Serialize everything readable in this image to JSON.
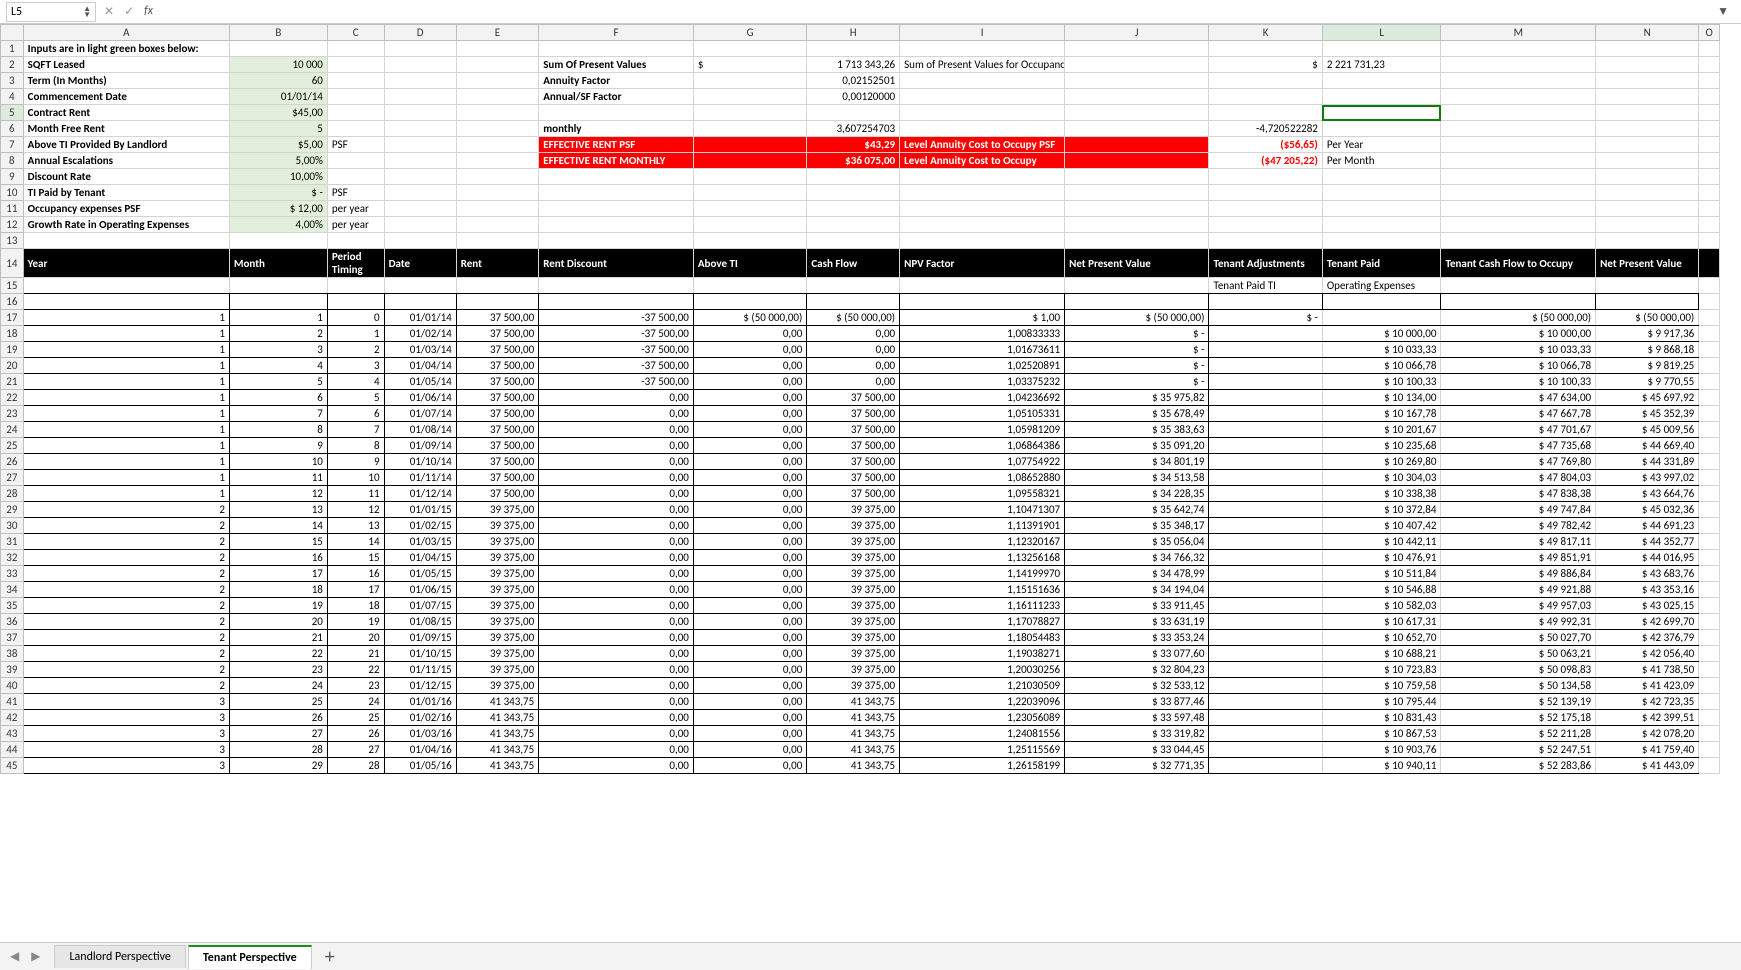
{
  "formula_bar": {
    "cell_ref": "L5",
    "fx": "fx",
    "formula": ""
  },
  "tabs": {
    "prev": "◀",
    "next": "▶",
    "t1": "Landlord Perspective",
    "t2": "Tenant Perspective",
    "add": "＋"
  },
  "cols": [
    "",
    "A",
    "B",
    "C",
    "D",
    "E",
    "F",
    "G",
    "H",
    "I",
    "J",
    "K",
    "L",
    "M",
    "N",
    "O"
  ],
  "r1": {
    "A": "Inputs are in light green boxes below:"
  },
  "r2": {
    "A": "SQFT Leased",
    "B": "10 000",
    "F": "Sum Of Present Values",
    "G": "$",
    "H": "1 713 343,26",
    "I": "Sum of Present Values for Occupancy",
    "K": "$",
    "L": "2 221 731,23"
  },
  "r3": {
    "A": "Term (In Months)",
    "B": "60",
    "F": "Annuity Factor",
    "H": "0,02152501"
  },
  "r4": {
    "A": "Commencement Date",
    "B": "01/01/14",
    "F": "Annual/SF Factor",
    "H": "0,00120000"
  },
  "r5": {
    "A": "Contract Rent",
    "B": "$45,00"
  },
  "r6": {
    "A": "Month Free Rent",
    "B": "5",
    "F": "monthly",
    "H": "3,607254703",
    "K": "-4,720522282"
  },
  "r7": {
    "A": "Above TI Provided By Landlord",
    "B": "$5,00",
    "C": "PSF",
    "F": "EFFECTIVE RENT PSF",
    "H": "$43,29",
    "I": "Level Annuity Cost to Occupy PSF",
    "K": "($56,65)",
    "L": "Per Year"
  },
  "r8": {
    "A": "Annual Escalations",
    "B": "5,00%",
    "F": "EFFECTIVE RENT MONTHLY",
    "H": "$36 075,00",
    "I": "Level Annuity Cost to Occupy",
    "K": "($47 205,22)",
    "L": "Per Month"
  },
  "r9": {
    "A": "Discount Rate",
    "B": "10,00%"
  },
  "r10": {
    "A": "TI Paid by Tenant",
    "Bp": "$",
    "B": "-",
    "C": "PSF"
  },
  "r11": {
    "A": "Occupancy expenses PSF",
    "Bp": "$",
    "B": "12,00",
    "C": "per year"
  },
  "r12": {
    "A": "Growth Rate in Operating Expenses",
    "B": "4,00%",
    "C": "per year"
  },
  "hdr": {
    "A": "Year",
    "B": "Month",
    "C": "Period Timing",
    "D": "Date",
    "E": "Rent",
    "F": "Rent Discount",
    "G": "Above TI",
    "H": "Cash Flow",
    "I": "NPV Factor",
    "J": "Net Present Value",
    "K": "Tenant Adjustments",
    "L": "Tenant Paid",
    "M": "Tenant Cash Flow to Occupy",
    "N": "Net Present Value"
  },
  "r15": {
    "K": "Tenant Paid TI",
    "L": "Operating Expenses"
  },
  "rows": [
    {
      "n": 17,
      "A": "1",
      "B": "1",
      "C": "0",
      "D": "01/01/14",
      "E": "37 500,00",
      "F": "-37 500,00",
      "Gp": "$",
      "G": "(50 000,00)",
      "Hp": "$",
      "H": "(50 000,00)",
      "Ip": "$",
      "I": "1,00",
      "Jp": "$",
      "J": "(50 000,00)",
      "Kp": "$",
      "K": "-",
      "Lp": "",
      "L": "",
      "Mp": "$",
      "M": "(50 000,00)",
      "Np": "$",
      "N": "(50 000,00)"
    },
    {
      "n": 18,
      "A": "1",
      "B": "2",
      "C": "1",
      "D": "01/02/14",
      "E": "37 500,00",
      "F": "-37 500,00",
      "G": "0,00",
      "H": "0,00",
      "I": "1,00833333",
      "Jp": "$",
      "J": "-",
      "Lp": "$",
      "L": "10 000,00",
      "Mp": "$",
      "M": "10 000,00",
      "Np": "$",
      "N": "9 917,36"
    },
    {
      "n": 19,
      "A": "1",
      "B": "3",
      "C": "2",
      "D": "01/03/14",
      "E": "37 500,00",
      "F": "-37 500,00",
      "G": "0,00",
      "H": "0,00",
      "I": "1,01673611",
      "Jp": "$",
      "J": "-",
      "Lp": "$",
      "L": "10 033,33",
      "Mp": "$",
      "M": "10 033,33",
      "Np": "$",
      "N": "9 868,18"
    },
    {
      "n": 20,
      "A": "1",
      "B": "4",
      "C": "3",
      "D": "01/04/14",
      "E": "37 500,00",
      "F": "-37 500,00",
      "G": "0,00",
      "H": "0,00",
      "I": "1,02520891",
      "Jp": "$",
      "J": "-",
      "Lp": "$",
      "L": "10 066,78",
      "Mp": "$",
      "M": "10 066,78",
      "Np": "$",
      "N": "9 819,25"
    },
    {
      "n": 21,
      "A": "1",
      "B": "5",
      "C": "4",
      "D": "01/05/14",
      "E": "37 500,00",
      "F": "-37 500,00",
      "G": "0,00",
      "H": "0,00",
      "I": "1,03375232",
      "Jp": "$",
      "J": "-",
      "Lp": "$",
      "L": "10 100,33",
      "Mp": "$",
      "M": "10 100,33",
      "Np": "$",
      "N": "9 770,55"
    },
    {
      "n": 22,
      "A": "1",
      "B": "6",
      "C": "5",
      "D": "01/06/14",
      "E": "37 500,00",
      "F": "0,00",
      "G": "0,00",
      "H": "37 500,00",
      "I": "1,04236692",
      "Jp": "$",
      "J": "35 975,82",
      "Lp": "$",
      "L": "10 134,00",
      "Mp": "$",
      "M": "47 634,00",
      "Np": "$",
      "N": "45 697,92"
    },
    {
      "n": 23,
      "A": "1",
      "B": "7",
      "C": "6",
      "D": "01/07/14",
      "E": "37 500,00",
      "F": "0,00",
      "G": "0,00",
      "H": "37 500,00",
      "I": "1,05105331",
      "Jp": "$",
      "J": "35 678,49",
      "Lp": "$",
      "L": "10 167,78",
      "Mp": "$",
      "M": "47 667,78",
      "Np": "$",
      "N": "45 352,39"
    },
    {
      "n": 24,
      "A": "1",
      "B": "8",
      "C": "7",
      "D": "01/08/14",
      "E": "37 500,00",
      "F": "0,00",
      "G": "0,00",
      "H": "37 500,00",
      "I": "1,05981209",
      "Jp": "$",
      "J": "35 383,63",
      "Lp": "$",
      "L": "10 201,67",
      "Mp": "$",
      "M": "47 701,67",
      "Np": "$",
      "N": "45 009,56"
    },
    {
      "n": 25,
      "A": "1",
      "B": "9",
      "C": "8",
      "D": "01/09/14",
      "E": "37 500,00",
      "F": "0,00",
      "G": "0,00",
      "H": "37 500,00",
      "I": "1,06864386",
      "Jp": "$",
      "J": "35 091,20",
      "Lp": "$",
      "L": "10 235,68",
      "Mp": "$",
      "M": "47 735,68",
      "Np": "$",
      "N": "44 669,40"
    },
    {
      "n": 26,
      "A": "1",
      "B": "10",
      "C": "9",
      "D": "01/10/14",
      "E": "37 500,00",
      "F": "0,00",
      "G": "0,00",
      "H": "37 500,00",
      "I": "1,07754922",
      "Jp": "$",
      "J": "34 801,19",
      "Lp": "$",
      "L": "10 269,80",
      "Mp": "$",
      "M": "47 769,80",
      "Np": "$",
      "N": "44 331,89"
    },
    {
      "n": 27,
      "A": "1",
      "B": "11",
      "C": "10",
      "D": "01/11/14",
      "E": "37 500,00",
      "F": "0,00",
      "G": "0,00",
      "H": "37 500,00",
      "I": "1,08652880",
      "Jp": "$",
      "J": "34 513,58",
      "Lp": "$",
      "L": "10 304,03",
      "Mp": "$",
      "M": "47 804,03",
      "Np": "$",
      "N": "43 997,02"
    },
    {
      "n": 28,
      "A": "1",
      "B": "12",
      "C": "11",
      "D": "01/12/14",
      "E": "37 500,00",
      "F": "0,00",
      "G": "0,00",
      "H": "37 500,00",
      "I": "1,09558321",
      "Jp": "$",
      "J": "34 228,35",
      "Lp": "$",
      "L": "10 338,38",
      "Mp": "$",
      "M": "47 838,38",
      "Np": "$",
      "N": "43 664,76"
    },
    {
      "n": 29,
      "A": "2",
      "B": "13",
      "C": "12",
      "D": "01/01/15",
      "E": "39 375,00",
      "F": "0,00",
      "G": "0,00",
      "H": "39 375,00",
      "I": "1,10471307",
      "Jp": "$",
      "J": "35 642,74",
      "Lp": "$",
      "L": "10 372,84",
      "Mp": "$",
      "M": "49 747,84",
      "Np": "$",
      "N": "45 032,36"
    },
    {
      "n": 30,
      "A": "2",
      "B": "14",
      "C": "13",
      "D": "01/02/15",
      "E": "39 375,00",
      "F": "0,00",
      "G": "0,00",
      "H": "39 375,00",
      "I": "1,11391901",
      "Jp": "$",
      "J": "35 348,17",
      "Lp": "$",
      "L": "10 407,42",
      "Mp": "$",
      "M": "49 782,42",
      "Np": "$",
      "N": "44 691,23"
    },
    {
      "n": 31,
      "A": "2",
      "B": "15",
      "C": "14",
      "D": "01/03/15",
      "E": "39 375,00",
      "F": "0,00",
      "G": "0,00",
      "H": "39 375,00",
      "I": "1,12320167",
      "Jp": "$",
      "J": "35 056,04",
      "Lp": "$",
      "L": "10 442,11",
      "Mp": "$",
      "M": "49 817,11",
      "Np": "$",
      "N": "44 352,77"
    },
    {
      "n": 32,
      "A": "2",
      "B": "16",
      "C": "15",
      "D": "01/04/15",
      "E": "39 375,00",
      "F": "0,00",
      "G": "0,00",
      "H": "39 375,00",
      "I": "1,13256168",
      "Jp": "$",
      "J": "34 766,32",
      "Lp": "$",
      "L": "10 476,91",
      "Mp": "$",
      "M": "49 851,91",
      "Np": "$",
      "N": "44 016,95"
    },
    {
      "n": 33,
      "A": "2",
      "B": "17",
      "C": "16",
      "D": "01/05/15",
      "E": "39 375,00",
      "F": "0,00",
      "G": "0,00",
      "H": "39 375,00",
      "I": "1,14199970",
      "Jp": "$",
      "J": "34 478,99",
      "Lp": "$",
      "L": "10 511,84",
      "Mp": "$",
      "M": "49 886,84",
      "Np": "$",
      "N": "43 683,76"
    },
    {
      "n": 34,
      "A": "2",
      "B": "18",
      "C": "17",
      "D": "01/06/15",
      "E": "39 375,00",
      "F": "0,00",
      "G": "0,00",
      "H": "39 375,00",
      "I": "1,15151636",
      "Jp": "$",
      "J": "34 194,04",
      "Lp": "$",
      "L": "10 546,88",
      "Mp": "$",
      "M": "49 921,88",
      "Np": "$",
      "N": "43 353,16"
    },
    {
      "n": 35,
      "A": "2",
      "B": "19",
      "C": "18",
      "D": "01/07/15",
      "E": "39 375,00",
      "F": "0,00",
      "G": "0,00",
      "H": "39 375,00",
      "I": "1,16111233",
      "Jp": "$",
      "J": "33 911,45",
      "Lp": "$",
      "L": "10 582,03",
      "Mp": "$",
      "M": "49 957,03",
      "Np": "$",
      "N": "43 025,15"
    },
    {
      "n": 36,
      "A": "2",
      "B": "20",
      "C": "19",
      "D": "01/08/15",
      "E": "39 375,00",
      "F": "0,00",
      "G": "0,00",
      "H": "39 375,00",
      "I": "1,17078827",
      "Jp": "$",
      "J": "33 631,19",
      "Lp": "$",
      "L": "10 617,31",
      "Mp": "$",
      "M": "49 992,31",
      "Np": "$",
      "N": "42 699,70"
    },
    {
      "n": 37,
      "A": "2",
      "B": "21",
      "C": "20",
      "D": "01/09/15",
      "E": "39 375,00",
      "F": "0,00",
      "G": "0,00",
      "H": "39 375,00",
      "I": "1,18054483",
      "Jp": "$",
      "J": "33 353,24",
      "Lp": "$",
      "L": "10 652,70",
      "Mp": "$",
      "M": "50 027,70",
      "Np": "$",
      "N": "42 376,79"
    },
    {
      "n": 38,
      "A": "2",
      "B": "22",
      "C": "21",
      "D": "01/10/15",
      "E": "39 375,00",
      "F": "0,00",
      "G": "0,00",
      "H": "39 375,00",
      "I": "1,19038271",
      "Jp": "$",
      "J": "33 077,60",
      "Lp": "$",
      "L": "10 688,21",
      "Mp": "$",
      "M": "50 063,21",
      "Np": "$",
      "N": "42 056,40"
    },
    {
      "n": 39,
      "A": "2",
      "B": "23",
      "C": "22",
      "D": "01/11/15",
      "E": "39 375,00",
      "F": "0,00",
      "G": "0,00",
      "H": "39 375,00",
      "I": "1,20030256",
      "Jp": "$",
      "J": "32 804,23",
      "Lp": "$",
      "L": "10 723,83",
      "Mp": "$",
      "M": "50 098,83",
      "Np": "$",
      "N": "41 738,50"
    },
    {
      "n": 40,
      "A": "2",
      "B": "24",
      "C": "23",
      "D": "01/12/15",
      "E": "39 375,00",
      "F": "0,00",
      "G": "0,00",
      "H": "39 375,00",
      "I": "1,21030509",
      "Jp": "$",
      "J": "32 533,12",
      "Lp": "$",
      "L": "10 759,58",
      "Mp": "$",
      "M": "50 134,58",
      "Np": "$",
      "N": "41 423,09"
    },
    {
      "n": 41,
      "A": "3",
      "B": "25",
      "C": "24",
      "D": "01/01/16",
      "E": "41 343,75",
      "F": "0,00",
      "G": "0,00",
      "H": "41 343,75",
      "I": "1,22039096",
      "Jp": "$",
      "J": "33 877,46",
      "Lp": "$",
      "L": "10 795,44",
      "Mp": "$",
      "M": "52 139,19",
      "Np": "$",
      "N": "42 723,35"
    },
    {
      "n": 42,
      "A": "3",
      "B": "26",
      "C": "25",
      "D": "01/02/16",
      "E": "41 343,75",
      "F": "0,00",
      "G": "0,00",
      "H": "41 343,75",
      "I": "1,23056089",
      "Jp": "$",
      "J": "33 597,48",
      "Lp": "$",
      "L": "10 831,43",
      "Mp": "$",
      "M": "52 175,18",
      "Np": "$",
      "N": "42 399,51"
    },
    {
      "n": 43,
      "A": "3",
      "B": "27",
      "C": "26",
      "D": "01/03/16",
      "E": "41 343,75",
      "F": "0,00",
      "G": "0,00",
      "H": "41 343,75",
      "I": "1,24081556",
      "Jp": "$",
      "J": "33 319,82",
      "Lp": "$",
      "L": "10 867,53",
      "Mp": "$",
      "M": "52 211,28",
      "Np": "$",
      "N": "42 078,20"
    },
    {
      "n": 44,
      "A": "3",
      "B": "28",
      "C": "27",
      "D": "01/04/16",
      "E": "41 343,75",
      "F": "0,00",
      "G": "0,00",
      "H": "41 343,75",
      "I": "1,25115569",
      "Jp": "$",
      "J": "33 044,45",
      "Lp": "$",
      "L": "10 903,76",
      "Mp": "$",
      "M": "52 247,51",
      "Np": "$",
      "N": "41 759,40"
    },
    {
      "n": 45,
      "A": "3",
      "B": "29",
      "C": "28",
      "D": "01/05/16",
      "E": "41 343,75",
      "F": "0,00",
      "G": "0,00",
      "H": "41 343,75",
      "I": "1,26158199",
      "Jp": "$",
      "J": "32 771,35",
      "Lp": "$",
      "L": "10 940,11",
      "Mp": "$",
      "M": "52 283,86",
      "Np": "$",
      "N": "41 443,09"
    }
  ]
}
